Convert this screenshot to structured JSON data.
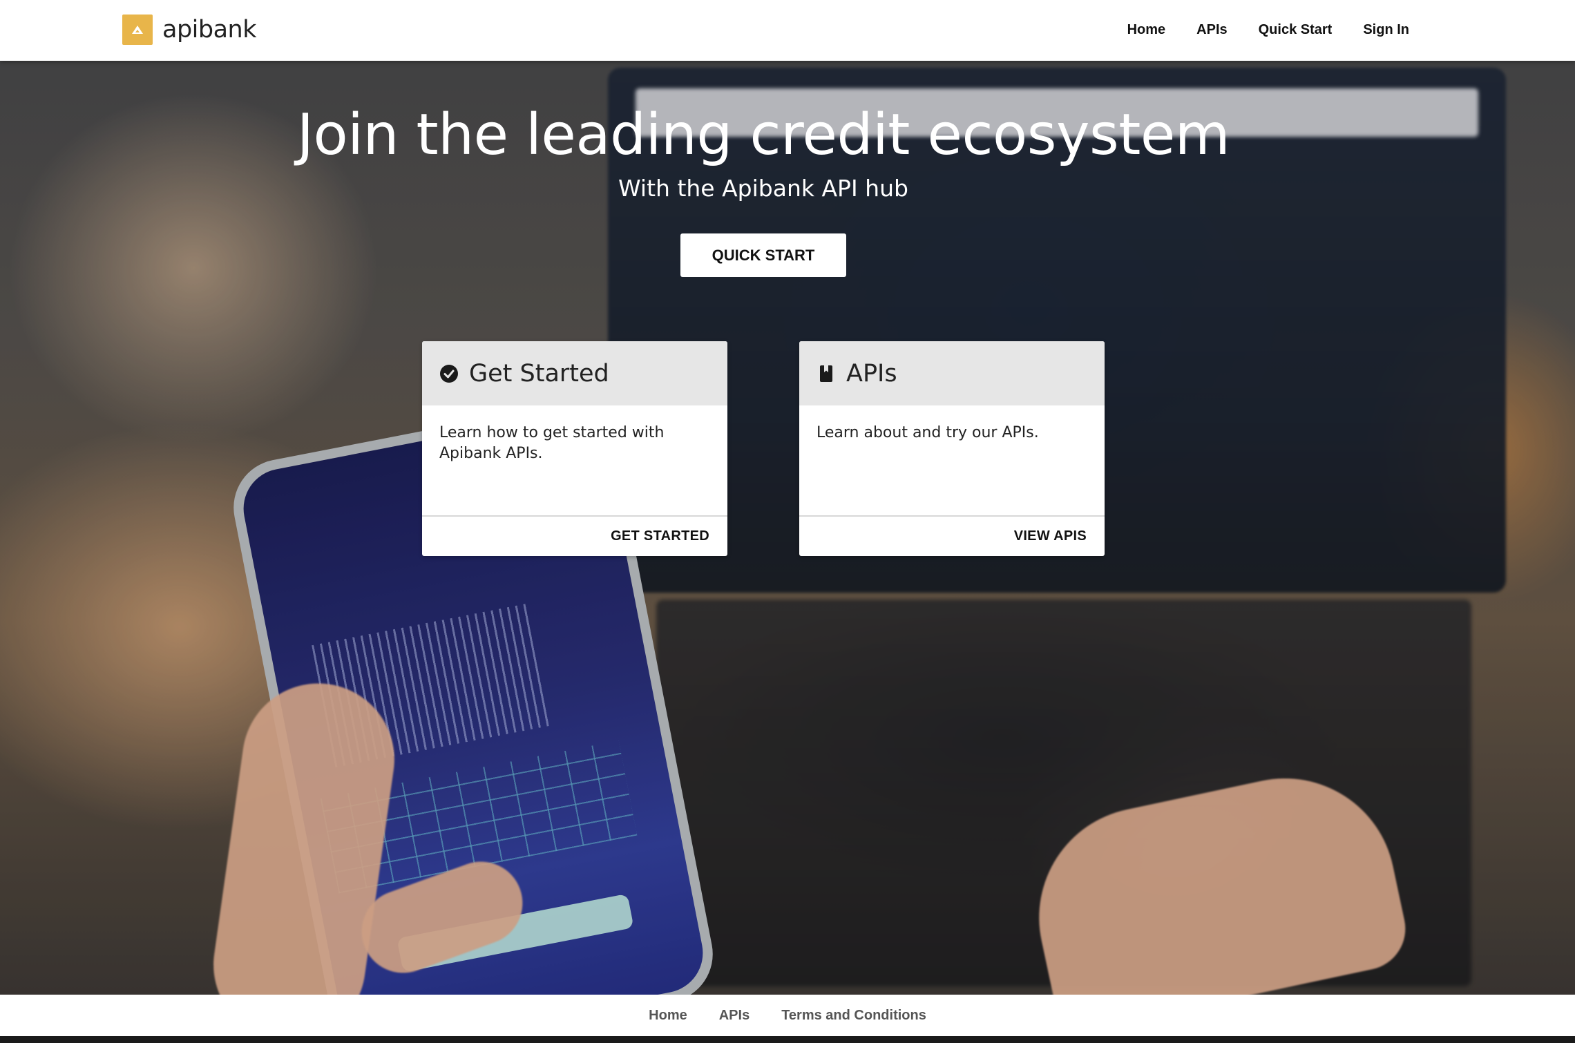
{
  "brand": {
    "name": "apibank",
    "logo_color": "#e8b54a"
  },
  "nav": {
    "items": [
      {
        "label": "Home"
      },
      {
        "label": "APIs"
      },
      {
        "label": "Quick Start"
      },
      {
        "label": "Sign In"
      }
    ]
  },
  "hero": {
    "title": "Join the leading credit ecosystem",
    "subtitle": "With the Apibank API hub",
    "cta_label": "QUICK START"
  },
  "cards": [
    {
      "icon": "check-circle-icon",
      "title": "Get Started",
      "description": "Learn how to get started with Apibank APIs.",
      "action_label": "GET STARTED"
    },
    {
      "icon": "book-icon",
      "title": "APIs",
      "description": "Learn about and try our APIs.",
      "action_label": "VIEW APIS"
    }
  ],
  "footer": {
    "links": [
      {
        "label": "Home"
      },
      {
        "label": "APIs"
      },
      {
        "label": "Terms and Conditions"
      }
    ]
  },
  "colors": {
    "header_bg": "#ffffff",
    "card_header_bg": "#e6e6e6",
    "footer_link": "#555555"
  }
}
